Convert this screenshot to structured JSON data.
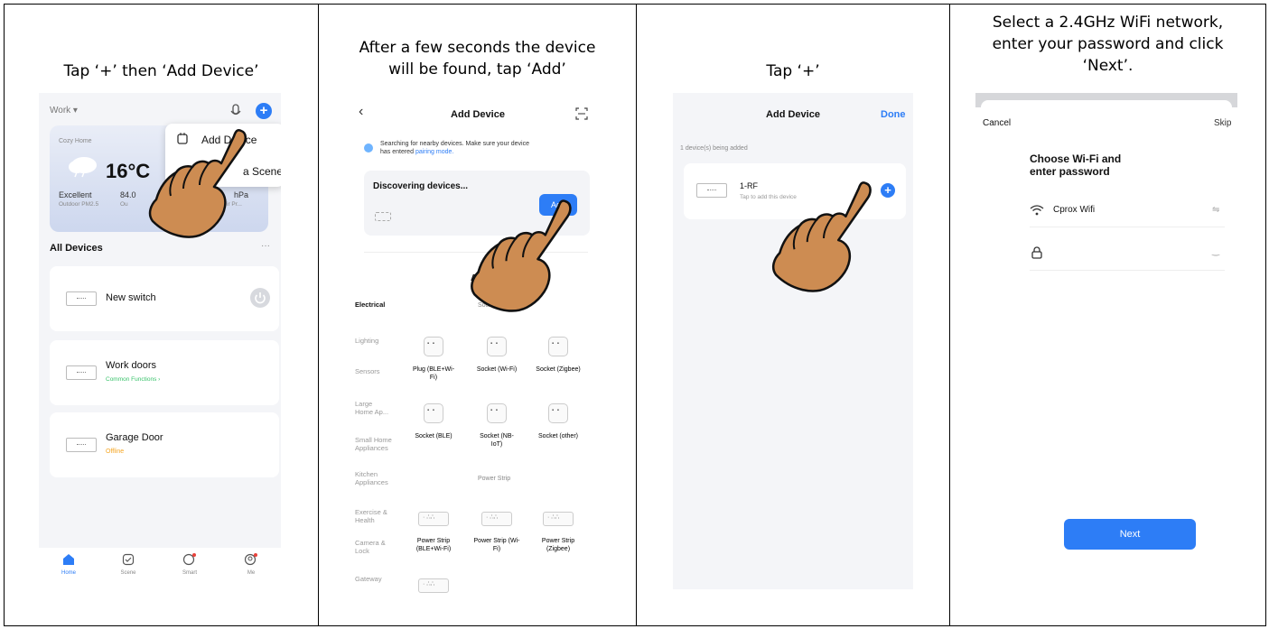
{
  "captions": {
    "step1": "Tap ‘+’ then ‘Add Device’",
    "step2_line1": "After a few seconds the device",
    "step2_line2": "will be found, tap ‘Add’",
    "step3": "Tap ‘+’",
    "step4_line1": "Select a 2.4GHz WiFi network,",
    "step4_line2": "enter your password and click",
    "step4_line3": "‘Next’."
  },
  "home": {
    "home_name": "Work",
    "weather_location": "Cozy Home",
    "temperature": "16°C",
    "air_quality": "Excellent",
    "air_quality_label": "Outdoor PM2.5",
    "humidity": "84.0",
    "humidity_label": "Ou",
    "pressure": "hPa",
    "pressure_label": "ir Pr...",
    "menu_add_device": "Add Device",
    "menu_create_scene": "a Scene",
    "all_devices": "All Devices",
    "more": "···",
    "devices": [
      {
        "name": "New switch",
        "status": ""
      },
      {
        "name": "Work doors",
        "status": "Common Functions ›"
      },
      {
        "name": "Garage Door",
        "status": "Offline"
      }
    ],
    "tabs": [
      "Home",
      "Scene",
      "Smart",
      "Me"
    ]
  },
  "add_device": {
    "title": "Add Device",
    "search_text_1": "Searching for nearby devices. Make sure your device",
    "search_text_2": "has entered",
    "pairing_mode": "pairing mode.",
    "discovering": "Discovering devices...",
    "add_button": "Add",
    "add_manual_partial": "Ad",
    "categories": [
      "Electrical",
      "Lighting",
      "Sensors",
      "Large Home Ap...",
      "Small Home Appliances",
      "Kitchen Appliances",
      "Exercise & Health",
      "Camera & Lock",
      "Gateway"
    ],
    "socket_header": "Socket",
    "sockets": [
      "Plug (BLE+Wi-Fi)",
      "Socket (Wi-Fi)",
      "Socket (Zigbee)",
      "Socket (BLE)",
      "Socket (NB-IoT)",
      "Socket (other)"
    ],
    "power_strip_header": "Power Strip",
    "strips": [
      "Power Strip (BLE+Wi-Fi)",
      "Power Strip (Wi-Fi)",
      "Power Strip (Zigbee)"
    ]
  },
  "adding": {
    "title": "Add Device",
    "done": "Done",
    "being_added": "1 device(s) being added",
    "device_name": "1-RF",
    "device_hint": "Tap to add this device"
  },
  "wifi": {
    "cancel": "Cancel",
    "skip": "Skip",
    "heading_line1": "Choose Wi-Fi and",
    "heading_line2": "enter password",
    "network": "Cprox Wifi",
    "next": "Next"
  },
  "colors": {
    "accent": "#2d7df6",
    "online_green": "#39c36b",
    "offline_orange": "#f5a623",
    "hand_skin": "#cd8c52"
  }
}
